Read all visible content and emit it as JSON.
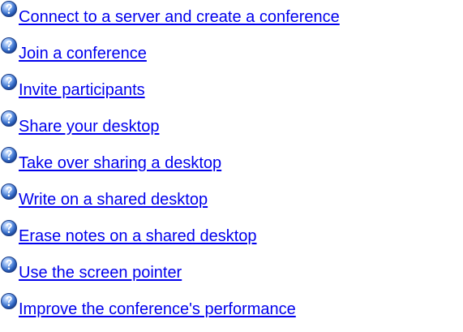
{
  "help_topics": {
    "icon": "help-question-icon",
    "link_color": "#0000ee",
    "items": [
      {
        "label": "Connect to a server and create a conference"
      },
      {
        "label": "Join a conference"
      },
      {
        "label": "Invite participants"
      },
      {
        "label": "Share your desktop"
      },
      {
        "label": "Take over sharing a desktop"
      },
      {
        "label": "Write on a shared desktop"
      },
      {
        "label": "Erase notes on a shared desktop"
      },
      {
        "label": "Use the screen pointer"
      },
      {
        "label": "Improve the conference's performance"
      }
    ]
  }
}
